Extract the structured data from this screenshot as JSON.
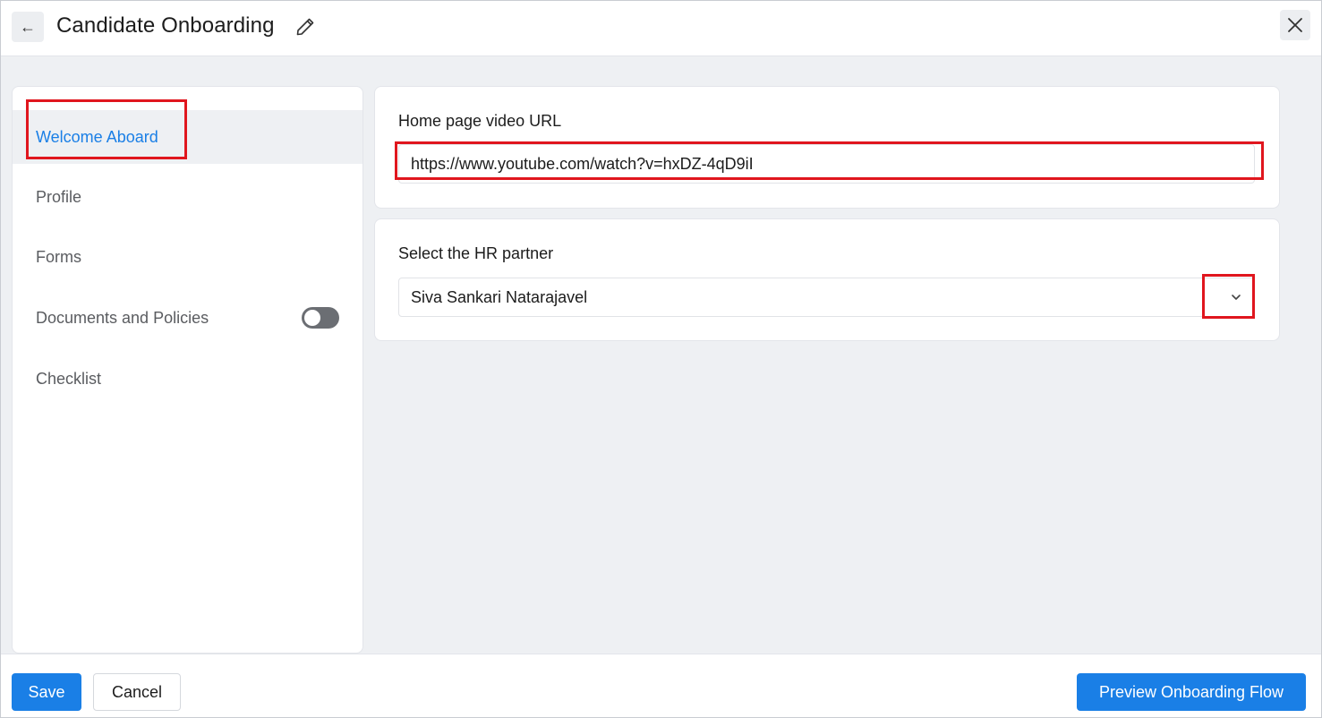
{
  "header": {
    "title": "Candidate Onboarding",
    "back_icon": "arrow-left-icon",
    "edit_icon": "pencil-icon",
    "close_icon": "close-icon"
  },
  "sidebar": {
    "items": [
      {
        "label": "Welcome Aboard",
        "active": true
      },
      {
        "label": "Profile",
        "active": false
      },
      {
        "label": "Forms",
        "active": false
      },
      {
        "label": "Documents and Policies",
        "active": false,
        "toggle": "off"
      },
      {
        "label": "Checklist",
        "active": false
      }
    ]
  },
  "video_card": {
    "label": "Home page video URL",
    "value": "https://www.youtube.com/watch?v=hxDZ-4qD9iI"
  },
  "hr_card": {
    "label": "Select the HR partner",
    "selected": "Siva Sankari Natarajavel",
    "chevron_icon": "chevron-down-icon"
  },
  "footer": {
    "save_label": "Save",
    "cancel_label": "Cancel",
    "preview_label": "Preview Onboarding Flow"
  },
  "colors": {
    "accent": "#1a7fe6",
    "highlight": "#e0161e",
    "background": "#eef0f3"
  }
}
